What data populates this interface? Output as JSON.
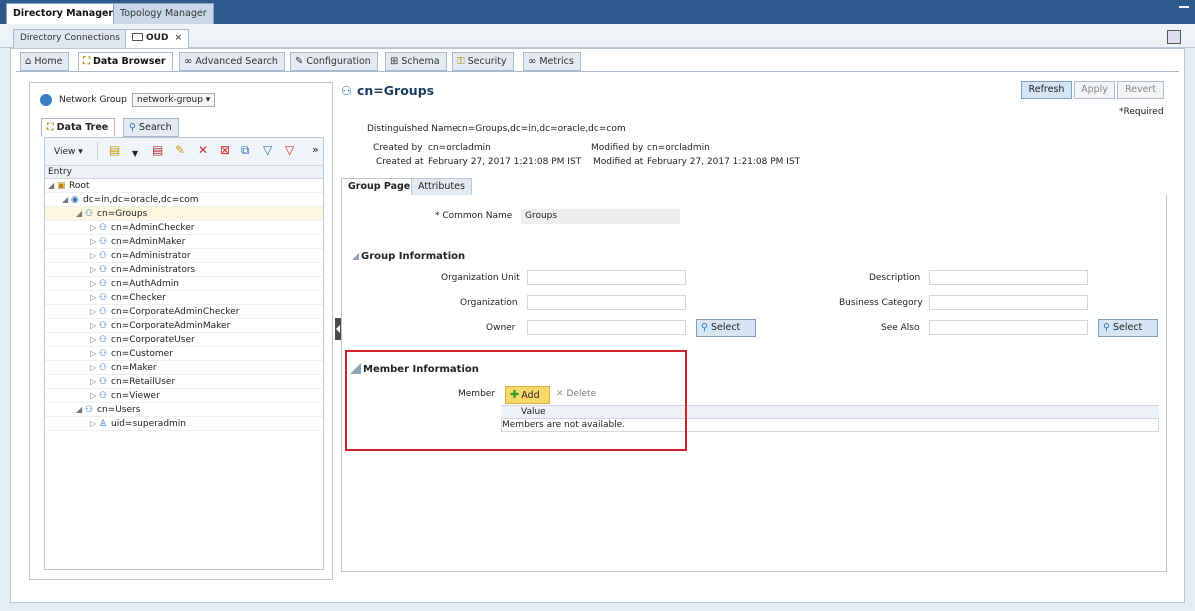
{
  "app_tabs": [
    "Directory Manager",
    "Topology Manager"
  ],
  "connection_tabs": {
    "directory_connections": "Directory Connections",
    "oud": "OUD"
  },
  "nav_tabs": [
    "Home",
    "Data Browser",
    "Advanced Search",
    "Configuration",
    "Schema",
    "Security",
    "Metrics"
  ],
  "left": {
    "network_group_label": "Network Group",
    "network_group_value": "network-group ▾",
    "tabs": [
      "Data Tree",
      "Search"
    ],
    "view_label": "View ▾",
    "column_header": "Entry",
    "tree": [
      "Root",
      "dc=in,dc=oracle,dc=com",
      "cn=Groups",
      "cn=AdminChecker",
      "cn=AdminMaker",
      "cn=Administrator",
      "cn=Administrators",
      "cn=AuthAdmin",
      "cn=Checker",
      "cn=CorporateAdminChecker",
      "cn=CorporateAdminMaker",
      "cn=CorporateUser",
      "cn=Customer",
      "cn=Maker",
      "cn=RetailUser",
      "cn=Viewer",
      "cn=Users",
      "uid=superadmin"
    ]
  },
  "right": {
    "title": "cn=Groups",
    "buttons": {
      "refresh": "Refresh",
      "apply": "Apply",
      "revert": "Revert"
    },
    "required_note": "*Required",
    "dn_label": "Distinguished Name",
    "dn_value": "cn=Groups,dc=in,dc=oracle,dc=com",
    "created_by_label": "Created by",
    "created_by_value": "cn=orcladmin",
    "created_at_label": "Created at",
    "created_at_value": "February 27, 2017 1:21:08 PM IST",
    "modified_by_label": "Modified by",
    "modified_by_value": "cn=orcladmin",
    "modified_at_label": "Modified at",
    "modified_at_value": "February 27, 2017 1:21:08 PM IST",
    "tabs": [
      "Group Page",
      "Attributes"
    ],
    "common_name_label": "* Common Name",
    "common_name_value": "Groups",
    "group_info_title": "Group Information",
    "org_unit_label": "Organization Unit",
    "organization_label": "Organization",
    "owner_label": "Owner",
    "description_label": "Description",
    "business_category_label": "Business Category",
    "see_also_label": "See Also",
    "select_label": "Select",
    "member_info_title": "Member Information",
    "member_label": "Member",
    "add_label": "Add",
    "delete_label": "Delete",
    "value_header": "Value",
    "empty_message": "Members are not available."
  }
}
